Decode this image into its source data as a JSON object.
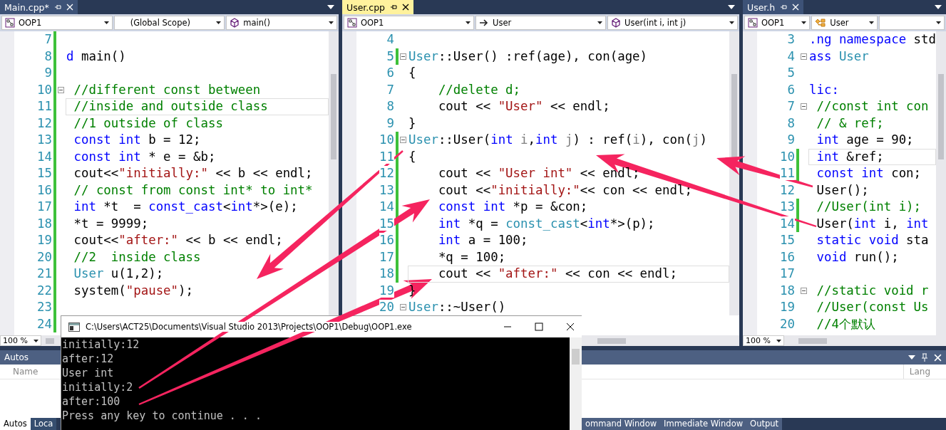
{
  "panes": [
    {
      "tabs": [
        {
          "label": "Main.cpp*",
          "selected": false
        }
      ],
      "nav": [
        {
          "text": "OOP1",
          "kind": "project"
        },
        {
          "text": "(Global Scope)",
          "kind": "none"
        },
        {
          "text": "main()",
          "kind": "method"
        }
      ],
      "zoom": "100 %",
      "lines": [
        {
          "n": "7",
          "changed": true,
          "current": false,
          "fold": false
        },
        {
          "n": "8",
          "changed": true,
          "current": false,
          "fold": false,
          "code": [
            {
              "text": "d",
              "kind": "kw"
            },
            {
              "text": " main()",
              "kind": "txt"
            }
          ]
        },
        {
          "n": "9",
          "changed": true,
          "current": false,
          "fold": false
        },
        {
          "n": "10",
          "changed": true,
          "current": false,
          "fold": true,
          "code": [
            {
              "text": " //different const between",
              "kind": "cm"
            }
          ]
        },
        {
          "n": "11",
          "changed": true,
          "current": true,
          "fold": false,
          "code": [
            {
              "text": " //inside and outside class",
              "kind": "cm"
            }
          ]
        },
        {
          "n": "12",
          "changed": true,
          "current": false,
          "fold": false,
          "code": [
            {
              "text": " //1 outside of class",
              "kind": "cm"
            }
          ]
        },
        {
          "n": "13",
          "changed": true,
          "current": false,
          "fold": false,
          "code": [
            {
              "text": " const int",
              "kind": "kw"
            },
            {
              "text": " b = 12;",
              "kind": "txt"
            }
          ]
        },
        {
          "n": "14",
          "changed": true,
          "current": false,
          "fold": false,
          "code": [
            {
              "text": " const int",
              "kind": "kw"
            },
            {
              "text": " * e = &b;",
              "kind": "txt"
            }
          ]
        },
        {
          "n": "15",
          "changed": true,
          "current": false,
          "fold": false,
          "code": [
            {
              "text": " cout<<",
              "kind": "txt"
            },
            {
              "text": "\"initially:\"",
              "kind": "str"
            },
            {
              "text": " << b << endl;",
              "kind": "txt"
            }
          ]
        },
        {
          "n": "16",
          "changed": true,
          "current": false,
          "fold": false,
          "code": [
            {
              "text": " // const from const int* to int*",
              "kind": "cm"
            }
          ]
        },
        {
          "n": "17",
          "changed": true,
          "current": false,
          "fold": false,
          "code": [
            {
              "text": " int",
              "kind": "kw"
            },
            {
              "text": " *t  = ",
              "kind": "txt"
            },
            {
              "text": "const_cast",
              "kind": "kw"
            },
            {
              "text": "<",
              "kind": "txt"
            },
            {
              "text": "int",
              "kind": "kw"
            },
            {
              "text": "*>(e);",
              "kind": "txt"
            }
          ]
        },
        {
          "n": "18",
          "changed": true,
          "current": false,
          "fold": false,
          "code": [
            {
              "text": " *t = 9999;",
              "kind": "txt"
            }
          ]
        },
        {
          "n": "19",
          "changed": true,
          "current": false,
          "fold": false,
          "code": [
            {
              "text": " cout<<",
              "kind": "txt"
            },
            {
              "text": "\"after:\"",
              "kind": "str"
            },
            {
              "text": " << b << endl;",
              "kind": "txt"
            }
          ]
        },
        {
          "n": "20",
          "changed": true,
          "current": false,
          "fold": false,
          "code": [
            {
              "text": " //2  inside class",
              "kind": "cm"
            }
          ]
        },
        {
          "n": "21",
          "changed": true,
          "current": false,
          "fold": false,
          "code": [
            {
              "text": " User",
              "kind": "type"
            },
            {
              "text": " u(1,2);",
              "kind": "txt"
            }
          ]
        },
        {
          "n": "22",
          "changed": true,
          "current": false,
          "fold": false,
          "code": [
            {
              "text": " system(",
              "kind": "txt"
            },
            {
              "text": "\"pause\"",
              "kind": "str"
            },
            {
              "text": ");",
              "kind": "txt"
            }
          ]
        },
        {
          "n": "23",
          "changed": true,
          "current": false,
          "fold": false
        },
        {
          "n": "24",
          "changed": true,
          "current": false,
          "fold": false
        }
      ]
    },
    {
      "tabs": [
        {
          "label": "User.cpp",
          "selected": true
        }
      ],
      "nav": [
        {
          "text": "OOP1",
          "kind": "project"
        },
        {
          "text": "User",
          "kind": "arrow"
        },
        {
          "text": "User(int i, int j)",
          "kind": "method"
        }
      ],
      "lines": [
        {
          "n": "4",
          "changed": false,
          "current": false,
          "fold": false
        },
        {
          "n": "5",
          "changed": true,
          "current": false,
          "fold": true,
          "code": [
            {
              "text": "User",
              "kind": "type"
            },
            {
              "text": "::User() :ref(age), con(age)",
              "kind": "txt"
            }
          ]
        },
        {
          "n": "6",
          "changed": false,
          "current": false,
          "fold": false,
          "code": [
            {
              "text": "{",
              "kind": "txt"
            }
          ]
        },
        {
          "n": "7",
          "changed": false,
          "current": false,
          "fold": false,
          "code": [
            {
              "text": "    //delete d;",
              "kind": "cm"
            }
          ]
        },
        {
          "n": "8",
          "changed": false,
          "current": false,
          "fold": false,
          "code": [
            {
              "text": "    cout << ",
              "kind": "txt"
            },
            {
              "text": "\"User\"",
              "kind": "str"
            },
            {
              "text": " << endl;",
              "kind": "txt"
            }
          ]
        },
        {
          "n": "9",
          "changed": false,
          "current": false,
          "fold": false,
          "code": [
            {
              "text": "}",
              "kind": "txt"
            }
          ]
        },
        {
          "n": "10",
          "changed": true,
          "current": false,
          "fold": true,
          "code": [
            {
              "text": "User",
              "kind": "type"
            },
            {
              "text": "::User(",
              "kind": "txt"
            },
            {
              "text": "int",
              "kind": "kw"
            },
            {
              "text": " i",
              "kind": "param"
            },
            {
              "text": ",",
              "kind": "txt"
            },
            {
              "text": "int",
              "kind": "kw"
            },
            {
              "text": " j",
              "kind": "param"
            },
            {
              "text": ") : ref(",
              "kind": "txt"
            },
            {
              "text": "i",
              "kind": "param"
            },
            {
              "text": "), con(",
              "kind": "txt"
            },
            {
              "text": "j",
              "kind": "param"
            },
            {
              "text": ")",
              "kind": "txt"
            }
          ]
        },
        {
          "n": "11",
          "changed": true,
          "current": false,
          "fold": false,
          "code": [
            {
              "text": "{",
              "kind": "txt"
            }
          ]
        },
        {
          "n": "12",
          "changed": true,
          "current": false,
          "fold": false,
          "code": [
            {
              "text": "    cout << ",
              "kind": "txt"
            },
            {
              "text": "\"User int\"",
              "kind": "str"
            },
            {
              "text": " << endl;",
              "kind": "txt"
            }
          ]
        },
        {
          "n": "13",
          "changed": true,
          "current": false,
          "fold": false,
          "code": [
            {
              "text": "    cout <<",
              "kind": "txt"
            },
            {
              "text": "\"initially:\"",
              "kind": "str"
            },
            {
              "text": "<< con << endl;",
              "kind": "txt"
            }
          ]
        },
        {
          "n": "14",
          "changed": true,
          "current": false,
          "fold": false,
          "code": [
            {
              "text": "    const int",
              "kind": "kw"
            },
            {
              "text": " *p = &con;",
              "kind": "txt"
            }
          ]
        },
        {
          "n": "15",
          "changed": true,
          "current": false,
          "fold": false,
          "code": [
            {
              "text": "    int",
              "kind": "kw"
            },
            {
              "text": " *q = ",
              "kind": "txt"
            },
            {
              "text": "const_cast",
              "kind": "type"
            },
            {
              "text": "<",
              "kind": "txt"
            },
            {
              "text": "int",
              "kind": "kw"
            },
            {
              "text": "*>(p);",
              "kind": "txt"
            }
          ]
        },
        {
          "n": "16",
          "changed": true,
          "current": false,
          "fold": false,
          "code": [
            {
              "text": "    int",
              "kind": "kw"
            },
            {
              "text": " a = 100;",
              "kind": "txt"
            }
          ]
        },
        {
          "n": "17",
          "changed": true,
          "current": false,
          "fold": false,
          "code": [
            {
              "text": "    *q = 100;",
              "kind": "txt"
            }
          ]
        },
        {
          "n": "18",
          "changed": true,
          "current": true,
          "fold": false,
          "code": [
            {
              "text": "    cout << ",
              "kind": "txt"
            },
            {
              "text": "\"after:\"",
              "kind": "str"
            },
            {
              "text": " << con << endl;",
              "kind": "txt"
            }
          ]
        },
        {
          "n": "19",
          "changed": false,
          "current": false,
          "fold": false,
          "code": [
            {
              "text": "}",
              "kind": "txt"
            }
          ]
        },
        {
          "n": "20",
          "changed": false,
          "current": false,
          "fold": true,
          "code": [
            {
              "text": "User",
              "kind": "type"
            },
            {
              "text": "::~User()",
              "kind": "txt"
            }
          ]
        }
      ]
    },
    {
      "tabs": [
        {
          "label": "User.h",
          "selected": false
        }
      ],
      "nav": [
        {
          "text": "OOP1",
          "kind": "project"
        },
        {
          "text": "User",
          "kind": "class"
        },
        {
          "kind": "none"
        }
      ],
      "zoom": "100 %",
      "lines": [
        {
          "n": "3",
          "changed": false,
          "current": false,
          "fold": false,
          "code": [
            {
              "text": ".ng namespace",
              "kind": "kw"
            },
            {
              "text": " std",
              "kind": "txt"
            }
          ]
        },
        {
          "n": "4",
          "changed": false,
          "current": false,
          "fold": true,
          "code": [
            {
              "text": "ass",
              "kind": "kw"
            },
            {
              "text": " User",
              "kind": "type"
            }
          ]
        },
        {
          "n": "5",
          "changed": false,
          "current": false,
          "fold": false
        },
        {
          "n": "6",
          "changed": false,
          "current": false,
          "fold": false,
          "code": [
            {
              "text": "lic:",
              "kind": "kw"
            }
          ]
        },
        {
          "n": "7",
          "changed": false,
          "current": false,
          "fold": true,
          "code": [
            {
              "text": " //const int con",
              "kind": "cm"
            }
          ]
        },
        {
          "n": "8",
          "changed": false,
          "current": false,
          "fold": false,
          "code": [
            {
              "text": " // & ref;",
              "kind": "cm"
            }
          ]
        },
        {
          "n": "9",
          "changed": false,
          "current": false,
          "fold": false,
          "code": [
            {
              "text": " int",
              "kind": "kw"
            },
            {
              "text": " age = 90;",
              "kind": "txt"
            }
          ]
        },
        {
          "n": "10",
          "changed": true,
          "current": true,
          "fold": false,
          "code": [
            {
              "text": " int",
              "kind": "kw"
            },
            {
              "text": " &ref;",
              "kind": "txt"
            }
          ]
        },
        {
          "n": "11",
          "changed": true,
          "current": false,
          "fold": false,
          "code": [
            {
              "text": " const int",
              "kind": "kw"
            },
            {
              "text": " con;",
              "kind": "txt"
            }
          ]
        },
        {
          "n": "12",
          "changed": false,
          "current": false,
          "fold": false,
          "code": [
            {
              "text": " User();",
              "kind": "txt"
            }
          ]
        },
        {
          "n": "13",
          "changed": true,
          "current": false,
          "fold": false,
          "code": [
            {
              "text": " //User(int i);",
              "kind": "cm"
            }
          ]
        },
        {
          "n": "14",
          "changed": true,
          "current": false,
          "fold": false,
          "code": [
            {
              "text": " User(",
              "kind": "txt"
            },
            {
              "text": "int",
              "kind": "kw"
            },
            {
              "text": " i, ",
              "kind": "txt"
            },
            {
              "text": "int",
              "kind": "kw"
            }
          ]
        },
        {
          "n": "15",
          "changed": false,
          "current": false,
          "fold": false,
          "code": [
            {
              "text": " static void",
              "kind": "kw"
            },
            {
              "text": " sta",
              "kind": "txt"
            }
          ]
        },
        {
          "n": "16",
          "changed": false,
          "current": false,
          "fold": false,
          "code": [
            {
              "text": " void",
              "kind": "kw"
            },
            {
              "text": " run();",
              "kind": "txt"
            }
          ]
        },
        {
          "n": "17",
          "changed": false,
          "current": false,
          "fold": false
        },
        {
          "n": "18",
          "changed": false,
          "current": false,
          "fold": true,
          "code": [
            {
              "text": " //static void r",
              "kind": "cm"
            }
          ]
        },
        {
          "n": "19",
          "changed": false,
          "current": false,
          "fold": false,
          "code": [
            {
              "text": " //User(const Us",
              "kind": "cm"
            }
          ]
        },
        {
          "n": "20",
          "changed": false,
          "current": false,
          "fold": false,
          "code": [
            {
              "text": " //4个默认",
              "kind": "cm"
            }
          ]
        }
      ]
    }
  ],
  "autos": {
    "title": "Autos",
    "columns": [
      "Name",
      "Lang"
    ],
    "tabs": [
      {
        "label": "Autos",
        "selected": true
      },
      {
        "label": "Loca",
        "selected": false
      }
    ],
    "other_tabs": [
      {
        "label": "ommand Window",
        "selected": false
      },
      {
        "label": "Immediate Window",
        "selected": false
      },
      {
        "label": "Output",
        "selected": false
      }
    ]
  },
  "console": {
    "title": "C:\\Users\\ACT25\\Documents\\Visual Studio 2013\\Projects\\OOP1\\Debug\\OOP1.exe",
    "lines": [
      "initially:12",
      "after:12",
      "User int",
      "initially:2",
      "after:100",
      "Press any key to continue . . ."
    ]
  }
}
